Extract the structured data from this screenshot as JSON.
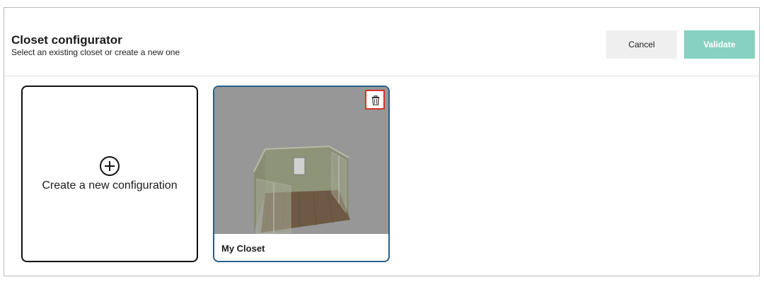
{
  "header": {
    "title": "Closet configurator",
    "subtitle": "Select an existing closet or create a new one",
    "cancel_label": "Cancel",
    "validate_label": "Validate"
  },
  "cards": {
    "new": {
      "label": "Create a new configuration",
      "icon": "plus-circle-icon"
    },
    "existing": [
      {
        "label": "My Closet",
        "icon": "trash-icon"
      }
    ]
  },
  "colors": {
    "accent_validate": "#86d1bf",
    "card_selected_border": "#2b5e84",
    "delete_border": "#d9322e"
  }
}
